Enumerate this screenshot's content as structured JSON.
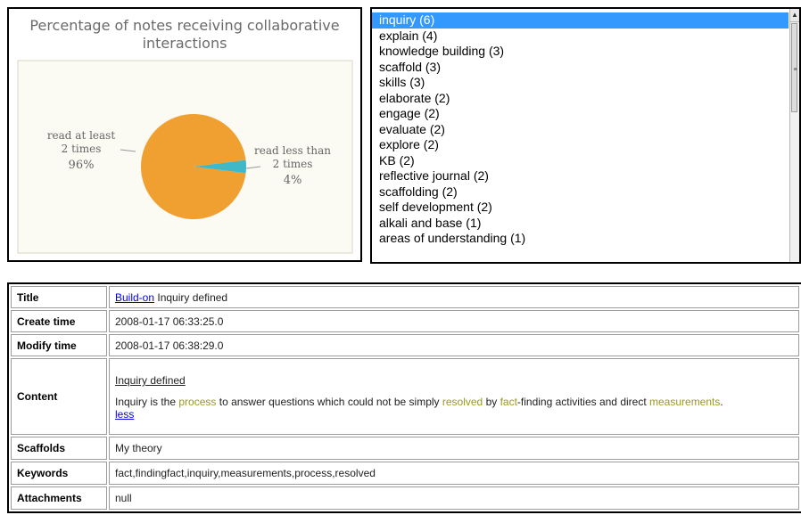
{
  "chart_data": {
    "type": "pie",
    "title": "Percentage of notes receiving collaborative interactions",
    "slices": [
      {
        "label_lines": [
          "read at least",
          "2 times"
        ],
        "percent_label": "96%",
        "value": 96,
        "color": "#f0a030"
      },
      {
        "label_lines": [
          "read less than",
          "2 times"
        ],
        "percent_label": "4%",
        "value": 4,
        "color": "#40b8c8"
      }
    ]
  },
  "keywords": {
    "selected_index": 0,
    "items": [
      "inquiry (6)",
      "explain (4)",
      "knowledge building (3)",
      "scaffold (3)",
      "skills (3)",
      "elaborate (2)",
      "engage (2)",
      "evaluate (2)",
      "explore (2)",
      "KB (2)",
      "reflective journal (2)",
      "scaffolding (2)",
      "self development (2)",
      "alkali and base (1)",
      "areas of understanding (1)"
    ]
  },
  "details": {
    "title_label": "Title",
    "title_link": "Build-on",
    "title_text": "Inquiry defined",
    "create_label": "Create time",
    "create_value": "2008-01-17 06:33:25.0",
    "modify_label": "Modify time",
    "modify_value": "2008-01-17 06:38:29.0",
    "content_label": "Content",
    "content_title": "Inquiry defined",
    "content_body": [
      {
        "t": "Inquiry is the "
      },
      {
        "t": "process",
        "k": true
      },
      {
        "t": " to answer questions which could not be simply "
      },
      {
        "t": "resolved",
        "k": true
      },
      {
        "t": " by "
      },
      {
        "t": "fact",
        "k": true
      },
      {
        "t": "-finding activities and direct "
      },
      {
        "t": "measurements",
        "k": true
      },
      {
        "t": "."
      }
    ],
    "less_link": "less",
    "scaffolds_label": "Scaffolds",
    "scaffolds_value": "My theory",
    "keywords_label": "Keywords",
    "keywords_value": "fact,findingfact,inquiry,measurements,process,resolved",
    "attachments_label": "Attachments",
    "attachments_value": "null"
  },
  "colors": {
    "selection": "#3399ff",
    "keyword_highlight": "#9a9a1a",
    "link": "#0000ee"
  }
}
